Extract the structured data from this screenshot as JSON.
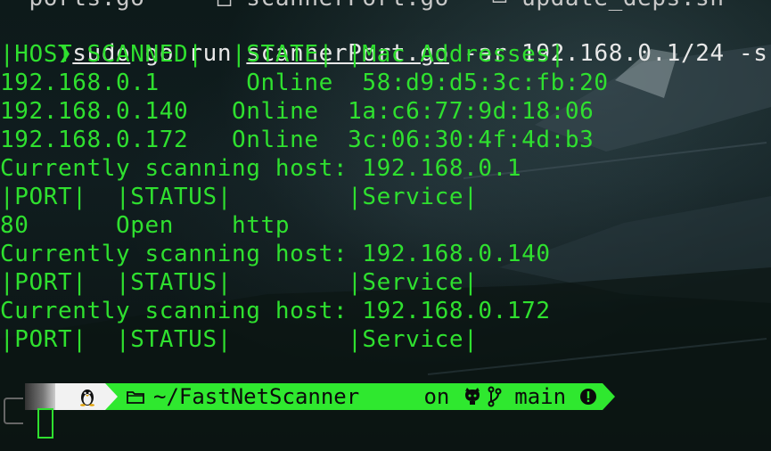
{
  "top_line": "  ports.go     □ scannerPort.go   ▭ update_deps.sh",
  "command": {
    "prompt_symbol": "❯",
    "sudo": "sudo",
    "go": "go",
    "run": " run ",
    "file": "scannerPort.go",
    "args": " -ar 192.168.0.1/24 -s"
  },
  "host_table": {
    "header": "|HOST SCANNED|  |STATE| |Mac Addresses|",
    "rows": [
      "192.168.0.1      Online  58:d9:d5:3c:fb:20",
      "192.168.0.140   Online  1a:c6:77:9d:18:06",
      "192.168.0.172   Online  3c:06:30:4f:4d:b3"
    ]
  },
  "scans": [
    {
      "scanning": "Currently scanning host: 192.168.0.1",
      "header": "|PORT|  |STATUS|        |Service|",
      "result": "80      Open    http"
    },
    {
      "scanning": "Currently scanning host: 192.168.0.140",
      "header": "|PORT|  |STATUS|        |Service|"
    },
    {
      "scanning": "Currently scanning host: 192.168.0.172",
      "header": "|PORT|  |STATUS|        |Service|"
    }
  ],
  "powerline": {
    "os_icon": "tux-icon",
    "folder_icon": "folder-icon",
    "directory": "~/FastNetScanner",
    "on": "on",
    "git_icon": "github-icon",
    "branch_icon": "git-branch-icon",
    "branch": "main",
    "status_icon": "alert-circle-icon"
  },
  "colors": {
    "text_green": "#2fe02f",
    "command_white": "#e8e8e8",
    "segment_green": "#2fe82f",
    "segment_white": "#f2f2f2"
  }
}
